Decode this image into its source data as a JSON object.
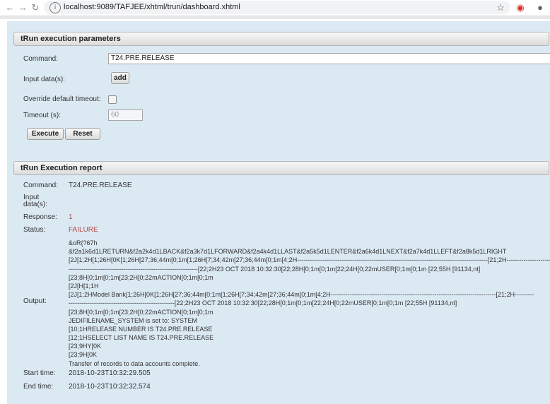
{
  "browser": {
    "url": "localhost:9089/TAFJEE/xhtml/trun/dashboard.xhtml"
  },
  "params": {
    "title": "tRun execution parameters",
    "command_label": "Command:",
    "command_value": "T24.PRE.RELEASE",
    "input_label": "Input data(s):",
    "add_label": "add",
    "override_label": "Override default timeout:",
    "timeout_label": "Timeout (s):",
    "timeout_value": "60",
    "execute_label": "Execute",
    "reset_label": "Reset"
  },
  "report": {
    "title": "tRun Execution report",
    "command_label": "Command:",
    "command_value": "T24.PRE.RELEASE",
    "input_label_1": "Input",
    "input_label_2": "data(s):",
    "response_label": "Response:",
    "response_value": "1",
    "status_label": "Status:",
    "status_value": "FAILURE",
    "output_label": "Output:",
    "output_lines": [
      "&oR{?67h",
      "&f2a1k6d1LRETURN&f2a2k4d1LBACK&f2a3k7d1LFORWARD&f2a4k4d1LLAST&f2a5k5d1LENTER&f2a6k4d1LNEXT&f2a7k4d1LLEFT&f2a8k5d1LRIGHT",
      "[2J[1;2H[1;26H[0K[1;26H[27;36;44m[0;1m[1;26H[7;34;42m[27;36;44m[0;1m[4;2H------------------------------------------------------------------------------------------[21;2H----------------------",
      "-------------------------------------------------------------[22;2H23 OCT 2018 10:32:30[22;28H[0;1m[0;1m[22;24H[0;22mUSER[0;1m[0;1m [22;55H [91134,nt]",
      "[23;8H[0;1m[0;1m[23;2H[0;22mACTION[0;1m[0;1m",
      "[2J[H[1;1H",
      "[2J[1;2HModel Bank[1;26H[0K[1;26H[27;36;44m[0;1m[1;26H[7;34;42m[27;36;44m[0;1m[4;2H------------------------------------------------------------------------------[21;2H---------",
      "--------------------------------------------------[22;2H23 OCT 2018 10:32:30[22;28H[0;1m[0;1m[22;24H[0;22mUSER[0;1m[0;1m [22;55H [91134,nt]",
      "[23;8H[0;1m[0;1m[23;2H[0;22mACTION[0;1m[0;1m",
      "JEDIFILENAME_SYSTEM is set to: SYSTEM",
      "[10;1HRELEASE NUMBER IS T24.PRE.RELEASE",
      "[12;1HSELECT LIST NAME IS T24.PRE.RELEASE",
      "[23;9HY[0K",
      "[23;9H[0K",
      "Transfer of records to data accounts complete."
    ],
    "start_label": "Start time:",
    "start_value": "2018-10-23T10:32:29.505",
    "end_label": "End time:",
    "end_value": "2018-10-23T10:32:32.574"
  },
  "colors": {
    "page_bg": "#dbe9f3",
    "failure": "#b84b4b"
  }
}
